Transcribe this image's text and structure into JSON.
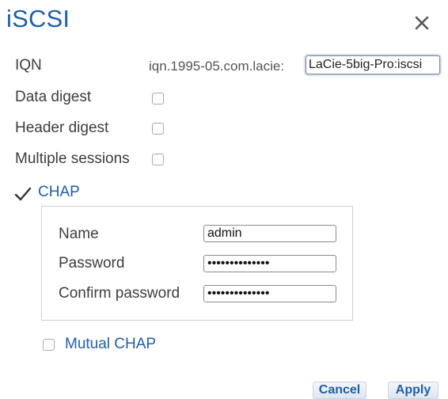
{
  "dialog": {
    "title": "iSCSI"
  },
  "form": {
    "iqn_label": "IQN",
    "iqn_prefix": "iqn.1995-05.com.lacie:",
    "iqn_value": "LaCie-5big-Pro:iscsi",
    "data_digest_label": "Data digest",
    "data_digest_checked": false,
    "header_digest_label": "Header digest",
    "header_digest_checked": false,
    "multiple_sessions_label": "Multiple sessions",
    "multiple_sessions_checked": false
  },
  "chap": {
    "label": "CHAP",
    "checked": true,
    "name_label": "Name",
    "name_value": "admin",
    "password_label": "Password",
    "password_value": "••••••••••••••",
    "confirm_label": "Confirm password",
    "confirm_value": "••••••••••••••"
  },
  "mutual_chap": {
    "label": "Mutual CHAP",
    "checked": false
  },
  "buttons": {
    "cancel": "Cancel",
    "apply": "Apply"
  },
  "colors": {
    "accent": "#1f5fa8",
    "text": "#3d3d3d"
  },
  "icons": {
    "close": "close-icon",
    "check": "checkmark-icon"
  }
}
